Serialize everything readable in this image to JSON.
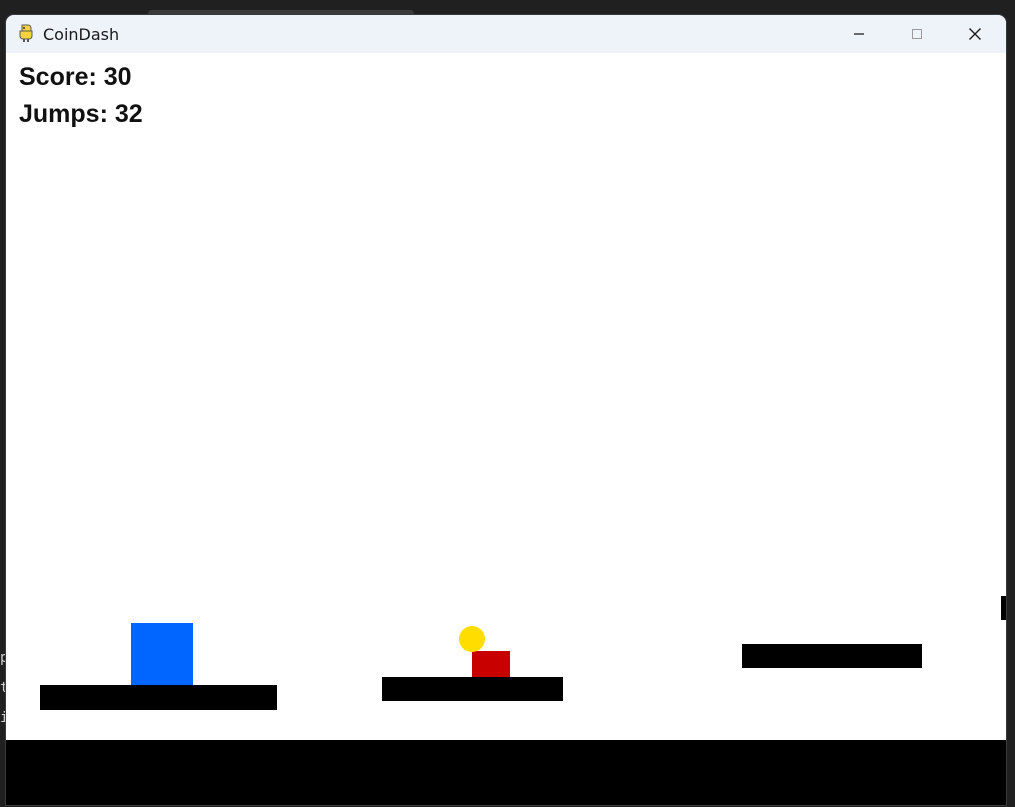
{
  "window": {
    "title": "CoinDash",
    "icon": "pygame-snake-icon",
    "controls": {
      "minimize_icon": "minimize-icon",
      "maximize_icon": "maximize-icon",
      "close_icon": "close-icon"
    }
  },
  "hud": {
    "score_text": "Score: 30",
    "jumps_text": "Jumps: 32"
  },
  "background_terminal": {
    "visible_chars": [
      "p",
      "t",
      "i"
    ]
  },
  "colors": {
    "player": "#0066ff",
    "enemy": "#c80000",
    "coin": "#ffdd00",
    "platform": "#000000",
    "background": "#ffffff"
  }
}
